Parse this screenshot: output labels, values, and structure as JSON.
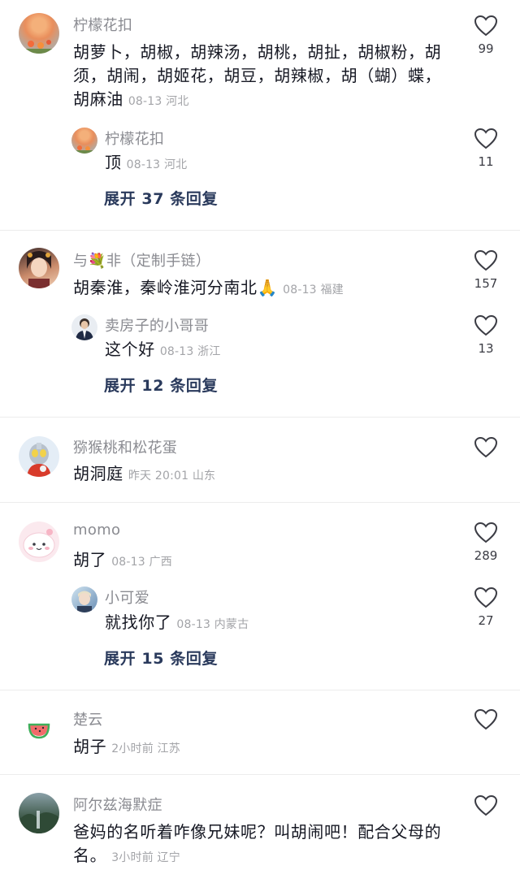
{
  "threads": [
    {
      "comment": {
        "user": "柠檬花扣",
        "text": "胡萝卜，胡椒，胡辣汤，胡桃，胡扯，胡椒粉，胡须，胡闹，胡姬花，胡豆，胡辣椒，胡（蝴）蝶，胡麻油",
        "meta": "08-13 河北",
        "likes": "99"
      },
      "reply": {
        "user": "柠檬花扣",
        "text": "顶",
        "meta": "08-13 河北",
        "likes": "11"
      },
      "expand": "展开 37 条回复"
    },
    {
      "comment": {
        "user": "与💐非（定制手链）",
        "text": "胡秦淮，秦岭淮河分南北🙏",
        "meta": "08-13 福建",
        "likes": "157"
      },
      "reply": {
        "user": "卖房子的小哥哥",
        "text": "这个好",
        "meta": "08-13 浙江",
        "likes": "13"
      },
      "expand": "展开 12 条回复"
    },
    {
      "comment": {
        "user": "猕猴桃和松花蛋",
        "text": "胡洞庭",
        "meta": "昨天 20:01 山东",
        "likes": ""
      }
    },
    {
      "comment": {
        "user": "momo",
        "text": "胡了",
        "meta": "08-13 广西",
        "likes": "289"
      },
      "reply": {
        "user": "小可爱",
        "text": "就找你了",
        "meta": "08-13 内蒙古",
        "likes": "27"
      },
      "expand": "展开 15 条回复"
    },
    {
      "comment": {
        "user": "楚云",
        "text": "胡子",
        "meta": "2小时前 江苏",
        "likes": ""
      }
    },
    {
      "comment": {
        "user": "阿尔兹海默症",
        "text": "爸妈的名听着咋像兄妹呢？叫胡闹吧！配合父母的名。",
        "meta": "3小时前 辽宁",
        "likes": ""
      }
    }
  ],
  "icons": {
    "like": "heart-outline-icon"
  },
  "colors": {
    "username": "#8a8b91",
    "text": "#161823",
    "meta": "#a3a4a8",
    "expand": "#2a3a5c"
  }
}
